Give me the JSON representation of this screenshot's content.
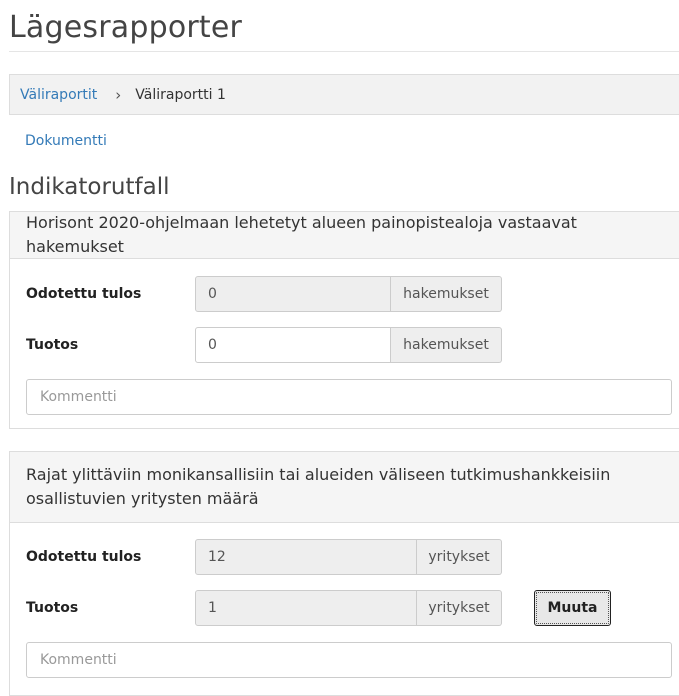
{
  "page": {
    "title": "Lägesrapporter"
  },
  "breadcrumb": {
    "parent": "Väliraportit",
    "separator": "›",
    "current": "Väliraportti 1"
  },
  "document_link": "Dokumentti",
  "section": {
    "title": "Indikatorutfall"
  },
  "indicators": [
    {
      "heading": "Horisont 2020-ohjelmaan lehetetyt alueen painopistealoja vastaavat hakemukset",
      "expected_label": "Odotettu tulos",
      "expected_value": "0",
      "expected_unit": "hakemukset",
      "output_label": "Tuotos",
      "output_value": "0",
      "output_unit": "hakemukset",
      "comment_placeholder": "Kommentti"
    },
    {
      "heading": "Rajat ylittäviin monikansallisiin tai alueiden väliseen tutkimushankkeisiin osallistuvien yritysten määrä",
      "expected_label": "Odotettu tulos",
      "expected_value": "12",
      "expected_unit": "yritykset",
      "output_label": "Tuotos",
      "output_value": "1",
      "output_unit": "yritykset",
      "change_button": "Muuta",
      "comment_placeholder": "Kommentti"
    }
  ]
}
